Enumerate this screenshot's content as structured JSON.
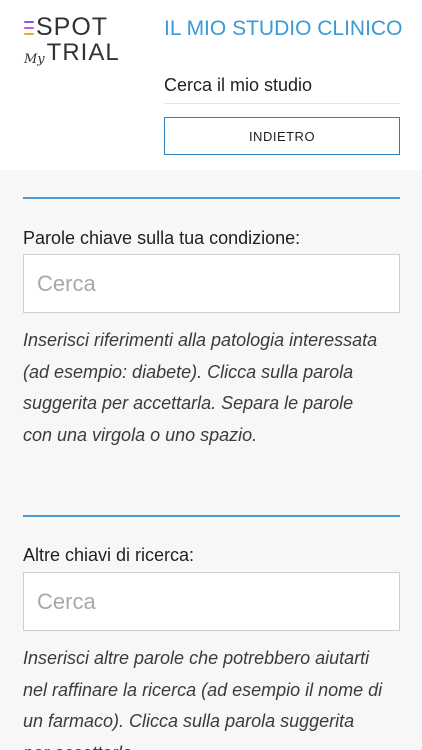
{
  "colors": {
    "accent": "#3a9ad6",
    "divider": "#4a9bd4",
    "button_border": "#2f7fb8",
    "content_bg": "#f7f7f7",
    "logo_bars": [
      "#7b5ce0",
      "#d65bc0",
      "#f0a040"
    ]
  },
  "logo": {
    "top_text": "SPOT",
    "my_text": "My",
    "bottom_text": "TRIAL"
  },
  "header": {
    "title": "IL MIO STUDIO CLINICO",
    "subtitle": "Cerca il mio studio",
    "back_label": "INDIETRO"
  },
  "form": {
    "keywords": {
      "label": "Parole chiave sulla tua condizione:",
      "placeholder": "Cerca",
      "help": "Inserisci riferimenti alla patologia interessata (ad esempio: diabete). Clicca sulla parola suggerita per accettarla. Separa le parole con una virgola o uno spazio."
    },
    "other_keys": {
      "label": "Altre chiavi di ricerca:",
      "placeholder": "Cerca",
      "help": "Inserisci altre parole che potrebbero aiutarti nel raffinare la ricerca (ad esempio il nome di un farmaco). Clicca sulla parola suggerita per accettarla."
    }
  }
}
